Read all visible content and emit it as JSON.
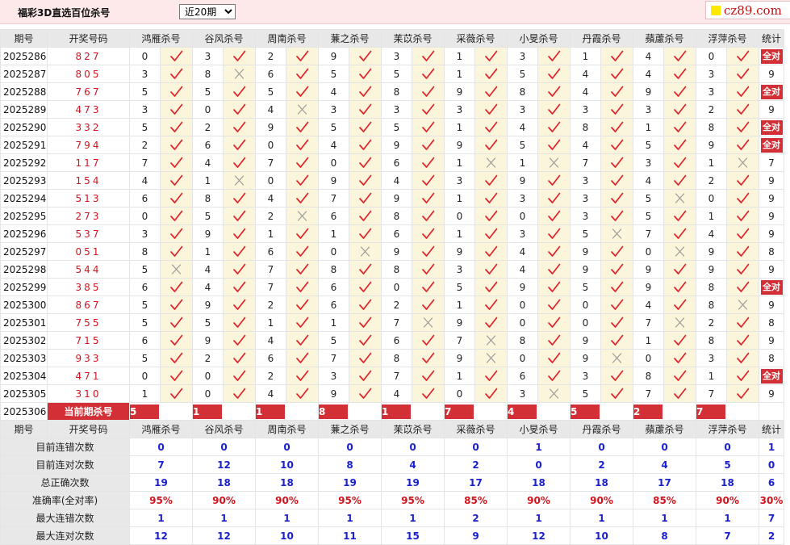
{
  "header": {
    "title": "福彩3D直选百位杀号",
    "period_selected": "近20期",
    "period_options": [
      "近20期"
    ],
    "logo_text": "cz89.com"
  },
  "colors": {
    "accent_red": "#d23036",
    "blue_stat": "#1a1fd0",
    "topbar_pink": "#fde8ea"
  },
  "table": {
    "columns": [
      "期号",
      "开奖号码",
      "鸿雁杀号",
      "谷风杀号",
      "周南杀号",
      "蒹之杀号",
      "苿苡杀号",
      "采薇杀号",
      "小旻杀号",
      "丹霞杀号",
      "蘋藘杀号",
      "浮萍杀号",
      "统计"
    ],
    "rows": [
      {
        "period": "2025286",
        "draw": "827",
        "kills": [
          [
            "0",
            "ok"
          ],
          [
            "3",
            "ok"
          ],
          [
            "2",
            "ok"
          ],
          [
            "9",
            "ok"
          ],
          [
            "3",
            "ok"
          ],
          [
            "1",
            "ok"
          ],
          [
            "3",
            "ok"
          ],
          [
            "1",
            "ok"
          ],
          [
            "4",
            "ok"
          ],
          [
            "0",
            "ok"
          ]
        ],
        "stat": "全对"
      },
      {
        "period": "2025287",
        "draw": "805",
        "kills": [
          [
            "3",
            "ok"
          ],
          [
            "8",
            "x"
          ],
          [
            "6",
            "ok"
          ],
          [
            "5",
            "ok"
          ],
          [
            "5",
            "ok"
          ],
          [
            "1",
            "ok"
          ],
          [
            "5",
            "ok"
          ],
          [
            "4",
            "ok"
          ],
          [
            "4",
            "ok"
          ],
          [
            "3",
            "ok"
          ]
        ],
        "stat": "9"
      },
      {
        "period": "2025288",
        "draw": "767",
        "kills": [
          [
            "5",
            "ok"
          ],
          [
            "5",
            "ok"
          ],
          [
            "5",
            "ok"
          ],
          [
            "4",
            "ok"
          ],
          [
            "8",
            "ok"
          ],
          [
            "9",
            "ok"
          ],
          [
            "8",
            "ok"
          ],
          [
            "4",
            "ok"
          ],
          [
            "9",
            "ok"
          ],
          [
            "3",
            "ok"
          ]
        ],
        "stat": "全对"
      },
      {
        "period": "2025289",
        "draw": "473",
        "kills": [
          [
            "3",
            "ok"
          ],
          [
            "0",
            "ok"
          ],
          [
            "4",
            "x"
          ],
          [
            "3",
            "ok"
          ],
          [
            "3",
            "ok"
          ],
          [
            "3",
            "ok"
          ],
          [
            "3",
            "ok"
          ],
          [
            "3",
            "ok"
          ],
          [
            "3",
            "ok"
          ],
          [
            "2",
            "ok"
          ]
        ],
        "stat": "9"
      },
      {
        "period": "2025290",
        "draw": "332",
        "kills": [
          [
            "5",
            "ok"
          ],
          [
            "2",
            "ok"
          ],
          [
            "9",
            "ok"
          ],
          [
            "5",
            "ok"
          ],
          [
            "5",
            "ok"
          ],
          [
            "1",
            "ok"
          ],
          [
            "4",
            "ok"
          ],
          [
            "8",
            "ok"
          ],
          [
            "1",
            "ok"
          ],
          [
            "8",
            "ok"
          ]
        ],
        "stat": "全对"
      },
      {
        "period": "2025291",
        "draw": "794",
        "kills": [
          [
            "2",
            "ok"
          ],
          [
            "6",
            "ok"
          ],
          [
            "0",
            "ok"
          ],
          [
            "4",
            "ok"
          ],
          [
            "9",
            "ok"
          ],
          [
            "9",
            "ok"
          ],
          [
            "5",
            "ok"
          ],
          [
            "4",
            "ok"
          ],
          [
            "5",
            "ok"
          ],
          [
            "9",
            "ok"
          ]
        ],
        "stat": "全对"
      },
      {
        "period": "2025292",
        "draw": "117",
        "kills": [
          [
            "7",
            "ok"
          ],
          [
            "4",
            "ok"
          ],
          [
            "7",
            "ok"
          ],
          [
            "0",
            "ok"
          ],
          [
            "6",
            "ok"
          ],
          [
            "1",
            "x"
          ],
          [
            "1",
            "x"
          ],
          [
            "7",
            "ok"
          ],
          [
            "3",
            "ok"
          ],
          [
            "1",
            "x"
          ]
        ],
        "stat": "7"
      },
      {
        "period": "2025293",
        "draw": "154",
        "kills": [
          [
            "4",
            "ok"
          ],
          [
            "1",
            "x"
          ],
          [
            "0",
            "ok"
          ],
          [
            "9",
            "ok"
          ],
          [
            "4",
            "ok"
          ],
          [
            "3",
            "ok"
          ],
          [
            "9",
            "ok"
          ],
          [
            "3",
            "ok"
          ],
          [
            "4",
            "ok"
          ],
          [
            "2",
            "ok"
          ]
        ],
        "stat": "9"
      },
      {
        "period": "2025294",
        "draw": "513",
        "kills": [
          [
            "6",
            "ok"
          ],
          [
            "8",
            "ok"
          ],
          [
            "4",
            "ok"
          ],
          [
            "7",
            "ok"
          ],
          [
            "9",
            "ok"
          ],
          [
            "1",
            "ok"
          ],
          [
            "3",
            "ok"
          ],
          [
            "3",
            "ok"
          ],
          [
            "5",
            "x"
          ],
          [
            "0",
            "ok"
          ]
        ],
        "stat": "9"
      },
      {
        "period": "2025295",
        "draw": "273",
        "kills": [
          [
            "0",
            "ok"
          ],
          [
            "5",
            "ok"
          ],
          [
            "2",
            "x"
          ],
          [
            "6",
            "ok"
          ],
          [
            "8",
            "ok"
          ],
          [
            "0",
            "ok"
          ],
          [
            "0",
            "ok"
          ],
          [
            "3",
            "ok"
          ],
          [
            "5",
            "ok"
          ],
          [
            "1",
            "ok"
          ]
        ],
        "stat": "9"
      },
      {
        "period": "2025296",
        "draw": "537",
        "kills": [
          [
            "3",
            "ok"
          ],
          [
            "9",
            "ok"
          ],
          [
            "1",
            "ok"
          ],
          [
            "1",
            "ok"
          ],
          [
            "6",
            "ok"
          ],
          [
            "1",
            "ok"
          ],
          [
            "3",
            "ok"
          ],
          [
            "5",
            "x"
          ],
          [
            "7",
            "ok"
          ],
          [
            "4",
            "ok"
          ]
        ],
        "stat": "9"
      },
      {
        "period": "2025297",
        "draw": "051",
        "kills": [
          [
            "8",
            "ok"
          ],
          [
            "1",
            "ok"
          ],
          [
            "6",
            "ok"
          ],
          [
            "0",
            "x"
          ],
          [
            "9",
            "ok"
          ],
          [
            "9",
            "ok"
          ],
          [
            "4",
            "ok"
          ],
          [
            "9",
            "ok"
          ],
          [
            "0",
            "x"
          ],
          [
            "9",
            "ok"
          ]
        ],
        "stat": "8"
      },
      {
        "period": "2025298",
        "draw": "544",
        "kills": [
          [
            "5",
            "x"
          ],
          [
            "4",
            "ok"
          ],
          [
            "7",
            "ok"
          ],
          [
            "8",
            "ok"
          ],
          [
            "8",
            "ok"
          ],
          [
            "3",
            "ok"
          ],
          [
            "4",
            "ok"
          ],
          [
            "9",
            "ok"
          ],
          [
            "9",
            "ok"
          ],
          [
            "9",
            "ok"
          ]
        ],
        "stat": "9"
      },
      {
        "period": "2025299",
        "draw": "385",
        "kills": [
          [
            "6",
            "ok"
          ],
          [
            "4",
            "ok"
          ],
          [
            "7",
            "ok"
          ],
          [
            "6",
            "ok"
          ],
          [
            "0",
            "ok"
          ],
          [
            "5",
            "ok"
          ],
          [
            "9",
            "ok"
          ],
          [
            "5",
            "ok"
          ],
          [
            "9",
            "ok"
          ],
          [
            "8",
            "ok"
          ]
        ],
        "stat": "全对"
      },
      {
        "period": "2025300",
        "draw": "867",
        "kills": [
          [
            "5",
            "ok"
          ],
          [
            "9",
            "ok"
          ],
          [
            "2",
            "ok"
          ],
          [
            "6",
            "ok"
          ],
          [
            "2",
            "ok"
          ],
          [
            "1",
            "ok"
          ],
          [
            "0",
            "ok"
          ],
          [
            "0",
            "ok"
          ],
          [
            "4",
            "ok"
          ],
          [
            "8",
            "x"
          ]
        ],
        "stat": "9"
      },
      {
        "period": "2025301",
        "draw": "755",
        "kills": [
          [
            "5",
            "ok"
          ],
          [
            "5",
            "ok"
          ],
          [
            "1",
            "ok"
          ],
          [
            "1",
            "ok"
          ],
          [
            "7",
            "x"
          ],
          [
            "9",
            "ok"
          ],
          [
            "0",
            "ok"
          ],
          [
            "0",
            "ok"
          ],
          [
            "7",
            "x"
          ],
          [
            "2",
            "ok"
          ]
        ],
        "stat": "8"
      },
      {
        "period": "2025302",
        "draw": "715",
        "kills": [
          [
            "6",
            "ok"
          ],
          [
            "9",
            "ok"
          ],
          [
            "4",
            "ok"
          ],
          [
            "5",
            "ok"
          ],
          [
            "6",
            "ok"
          ],
          [
            "7",
            "x"
          ],
          [
            "8",
            "ok"
          ],
          [
            "9",
            "ok"
          ],
          [
            "1",
            "ok"
          ],
          [
            "8",
            "ok"
          ]
        ],
        "stat": "9"
      },
      {
        "period": "2025303",
        "draw": "933",
        "kills": [
          [
            "5",
            "ok"
          ],
          [
            "2",
            "ok"
          ],
          [
            "6",
            "ok"
          ],
          [
            "7",
            "ok"
          ],
          [
            "8",
            "ok"
          ],
          [
            "9",
            "x"
          ],
          [
            "0",
            "ok"
          ],
          [
            "9",
            "x"
          ],
          [
            "0",
            "ok"
          ],
          [
            "3",
            "ok"
          ]
        ],
        "stat": "8"
      },
      {
        "period": "2025304",
        "draw": "471",
        "kills": [
          [
            "0",
            "ok"
          ],
          [
            "0",
            "ok"
          ],
          [
            "2",
            "ok"
          ],
          [
            "3",
            "ok"
          ],
          [
            "7",
            "ok"
          ],
          [
            "1",
            "ok"
          ],
          [
            "6",
            "ok"
          ],
          [
            "3",
            "ok"
          ],
          [
            "8",
            "ok"
          ],
          [
            "1",
            "ok"
          ]
        ],
        "stat": "全对"
      },
      {
        "period": "2025305",
        "draw": "310",
        "kills": [
          [
            "1",
            "ok"
          ],
          [
            "0",
            "ok"
          ],
          [
            "4",
            "ok"
          ],
          [
            "9",
            "ok"
          ],
          [
            "4",
            "ok"
          ],
          [
            "0",
            "ok"
          ],
          [
            "3",
            "x"
          ],
          [
            "5",
            "ok"
          ],
          [
            "7",
            "ok"
          ],
          [
            "7",
            "ok"
          ]
        ],
        "stat": "9"
      }
    ],
    "current": {
      "period": "2025306",
      "label": "当前期杀号",
      "kills": [
        "5",
        "1",
        "1",
        "8",
        "1",
        "7",
        "4",
        "5",
        "2",
        "7"
      ]
    },
    "stats": [
      {
        "label": "目前连错次数",
        "values": [
          "0",
          "0",
          "0",
          "0",
          "0",
          "0",
          "1",
          "0",
          "0",
          "0",
          "1"
        ],
        "red": false
      },
      {
        "label": "目前连对次数",
        "values": [
          "7",
          "12",
          "10",
          "8",
          "4",
          "2",
          "0",
          "2",
          "4",
          "5",
          "0"
        ],
        "red": false
      },
      {
        "label": "总正确次数",
        "values": [
          "19",
          "18",
          "18",
          "19",
          "19",
          "17",
          "18",
          "18",
          "17",
          "18",
          "6"
        ],
        "red": false
      },
      {
        "label": "准确率(全对率)",
        "values": [
          "95%",
          "90%",
          "90%",
          "95%",
          "95%",
          "85%",
          "90%",
          "90%",
          "85%",
          "90%",
          "30%"
        ],
        "red": true
      },
      {
        "label": "最大连错次数",
        "values": [
          "1",
          "1",
          "1",
          "1",
          "1",
          "2",
          "1",
          "1",
          "1",
          "1",
          "7"
        ],
        "red": false
      },
      {
        "label": "最大连对次数",
        "values": [
          "12",
          "12",
          "10",
          "11",
          "15",
          "9",
          "12",
          "10",
          "8",
          "7",
          "2"
        ],
        "red": false
      }
    ]
  }
}
